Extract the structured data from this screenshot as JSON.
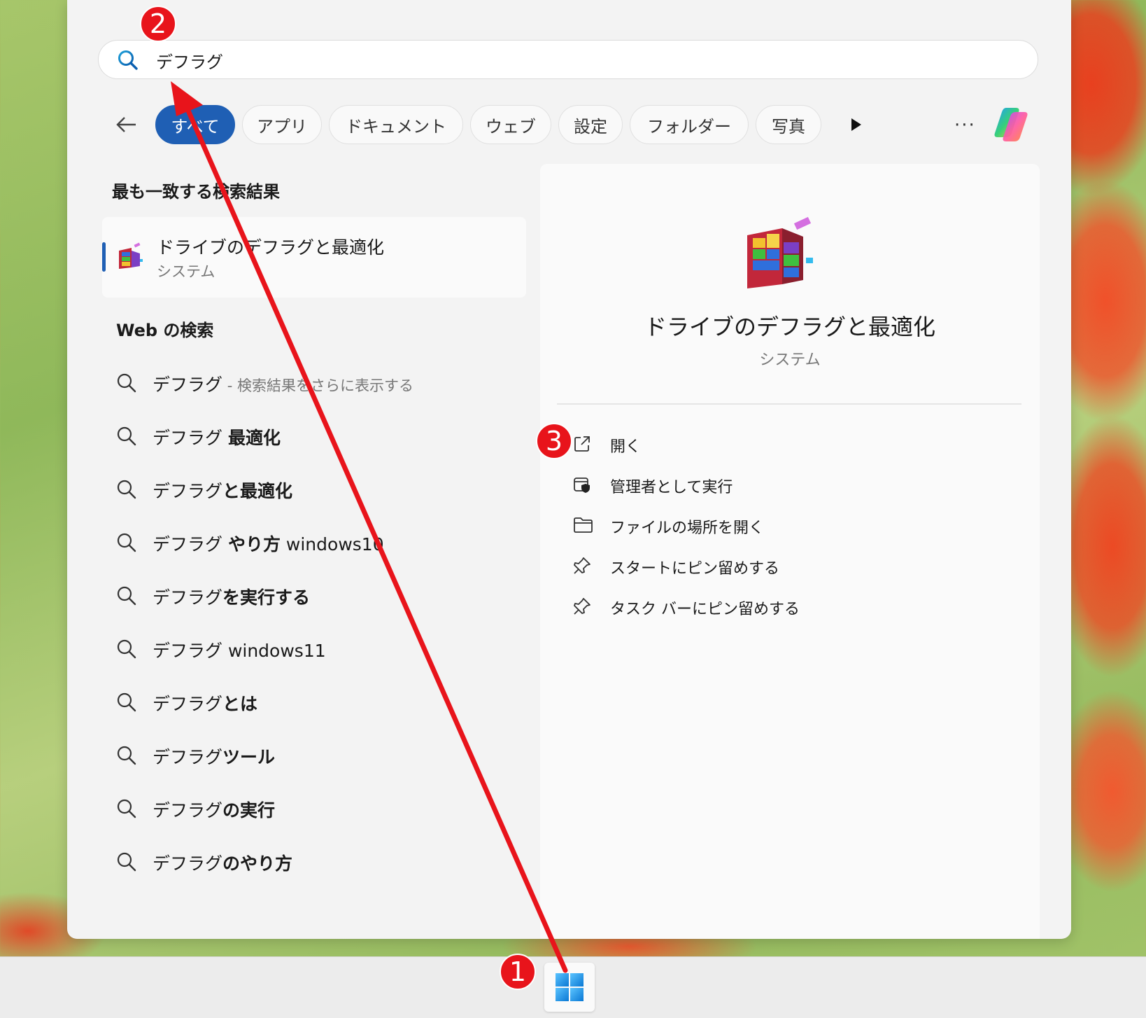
{
  "search": {
    "value": "デフラグ",
    "icon": "search-icon"
  },
  "filters": [
    {
      "label": "すべて",
      "active": true
    },
    {
      "label": "アプリ"
    },
    {
      "label": "ドキュメント"
    },
    {
      "label": "ウェブ"
    },
    {
      "label": "設定"
    },
    {
      "label": "フォルダー"
    },
    {
      "label": "写真"
    }
  ],
  "toolbar": {
    "more_label": "···"
  },
  "best_match": {
    "heading": "最も一致する検索結果",
    "name": "ドライブのデフラグと最適化",
    "category": "システム"
  },
  "web": {
    "heading": "Web の検索",
    "items": [
      {
        "base": "デフラグ",
        "bold": "",
        "hint": " - 検索結果をさらに表示する"
      },
      {
        "base": "デフラグ ",
        "bold": "最適化",
        "hint": ""
      },
      {
        "base": "デフラグ",
        "bold": "と最適化",
        "hint": ""
      },
      {
        "base": "デフラグ ",
        "bold": "やり方",
        "tail": " windows10",
        "hint": ""
      },
      {
        "base": "デフラグ",
        "bold": "を実行する",
        "hint": ""
      },
      {
        "base": "デフラグ windows11",
        "bold": "",
        "hint": ""
      },
      {
        "base": "デフラグ",
        "bold": "とは",
        "hint": ""
      },
      {
        "base": "デフラグ",
        "bold": "ツール",
        "hint": ""
      },
      {
        "base": "デフラグ",
        "bold": "の実行",
        "hint": ""
      },
      {
        "base": "デフラグ",
        "bold": "のやり方",
        "hint": ""
      }
    ]
  },
  "detail": {
    "title": "ドライブのデフラグと最適化",
    "category": "システム",
    "actions": [
      {
        "label": "開く",
        "icon": "open-external-icon"
      },
      {
        "label": "管理者として実行",
        "icon": "admin-shield-icon"
      },
      {
        "label": "ファイルの場所を開く",
        "icon": "folder-icon"
      },
      {
        "label": "スタートにピン留めする",
        "icon": "pin-icon"
      },
      {
        "label": "タスク バーにピン留めする",
        "icon": "pin-icon"
      }
    ]
  },
  "annotations": {
    "marker1": "1",
    "marker2": "2",
    "marker3": "3",
    "color": "#e8141b"
  },
  "colors": {
    "accent": "#1f5fb4",
    "panel": "#f3f3f3"
  }
}
